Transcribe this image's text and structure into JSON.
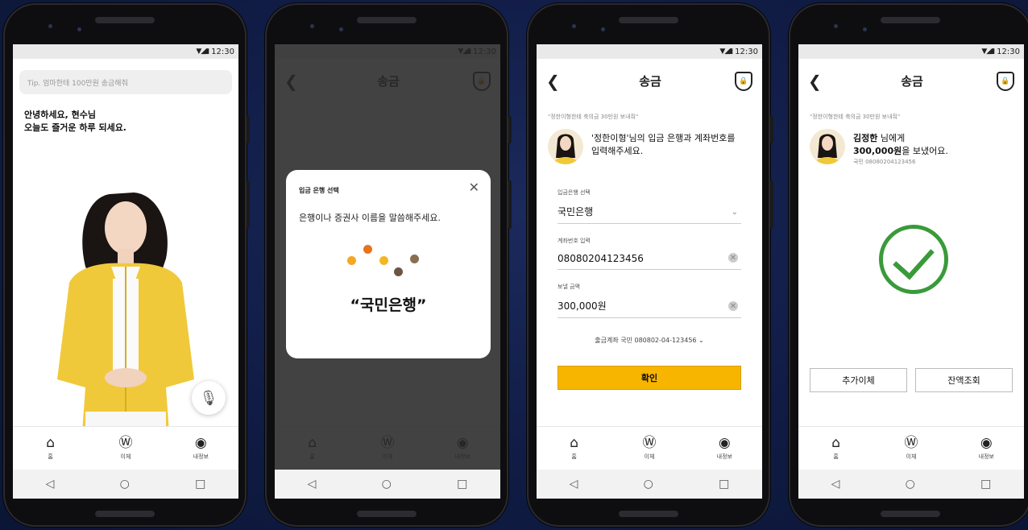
{
  "status": {
    "time": "12:30",
    "signal": "▼◢▮"
  },
  "tabs": [
    {
      "icon": "home-icon",
      "glyph": "⌂",
      "label": "홈"
    },
    {
      "icon": "w-transfer-icon",
      "glyph": "Ⓦ",
      "label": "이체"
    },
    {
      "icon": "profile-icon",
      "glyph": "◉",
      "label": "내정보"
    }
  ],
  "nav": {
    "back": "◁",
    "home": "○",
    "recent": "□"
  },
  "screen1": {
    "tip_placeholder": "Tip. 엄마한테 100만원 송금해줘",
    "greeting_line1": "안녕하세요, 현수님",
    "greeting_line2": "오늘도 즐거운 하루 되세요.",
    "mic_glyph": "🎙"
  },
  "transfer_header": {
    "back": "❮",
    "title": "송금"
  },
  "screen2": {
    "dialog_title": "입금 은행 선택",
    "close": "✕",
    "message": "은행이나 증권사 이름을 말씀해주세요.",
    "recognized": "“국민은행”"
  },
  "screen3": {
    "hint": "\"정한이형한테 축의금 30만원 보내줘\"",
    "who_line1": "'정한이형'님의 입금 은행과 계좌번호를",
    "who_line2": "입력해주세요.",
    "bank_label": "입금은행 선택",
    "bank_value": "국민은행",
    "account_label": "계좌번호 입력",
    "account_value": "08080204123456",
    "amount_label": "보낼 금액",
    "amount_value": "300,000원",
    "from_account": "출금계좌  국민 080802-04-123456 ⌄",
    "confirm": "확인"
  },
  "screen4": {
    "hint": "\"정한이형한테 축의금 30만원 보내줘\"",
    "name": "김정한",
    "name_suffix": " 님에게",
    "amount": "300,000원",
    "amount_suffix": "을 보냈어요.",
    "account": "국민 08080204123456",
    "btn_more": "추가이체",
    "btn_balance": "잔액조회"
  },
  "colors": {
    "accent": "#f7b500",
    "success": "#3a9a3a",
    "background": "#101c45"
  }
}
